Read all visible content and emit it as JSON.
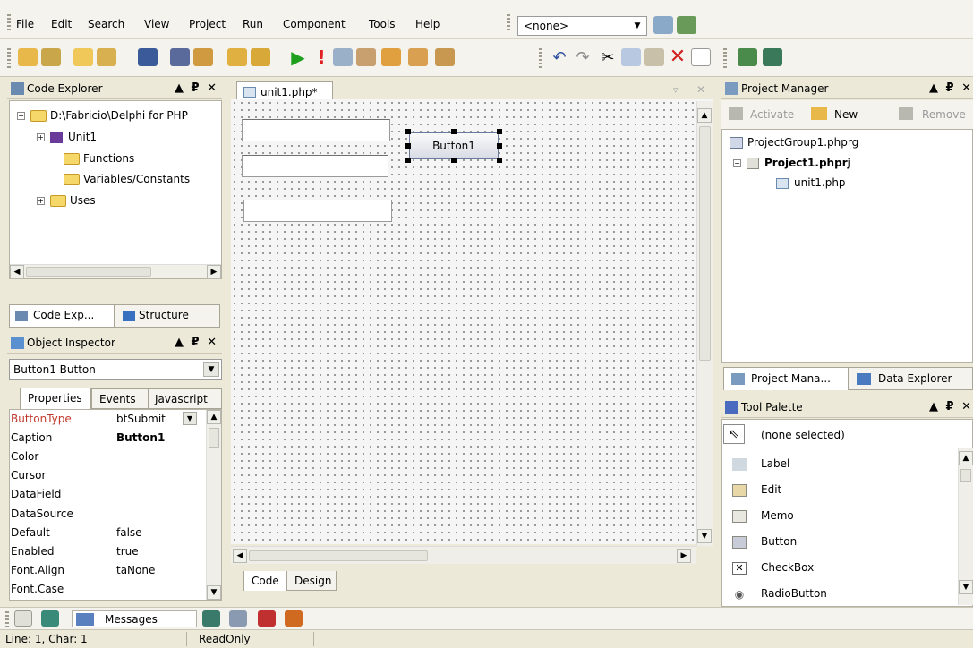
{
  "menubar": {
    "items": [
      "File",
      "Edit",
      "Search",
      "View",
      "Project",
      "Run",
      "Component",
      "Tools",
      "Help"
    ],
    "combo_value": "<none>"
  },
  "code_explorer": {
    "title": "Code Explorer",
    "root": "D:\\Fabricio\\Delphi for PHP",
    "unit": "Unit1",
    "functions": "Functions",
    "variables": "Variables/Constants",
    "uses": "Uses",
    "tab_code": "Code Exp...",
    "tab_structure": "Structure"
  },
  "object_inspector": {
    "title": "Object Inspector",
    "selected": "Button1  Button",
    "tabs": [
      "Properties",
      "Events",
      "Javascript"
    ],
    "rows": [
      {
        "name": "ButtonType",
        "value": "btSubmit"
      },
      {
        "name": "Caption",
        "value": "Button1"
      },
      {
        "name": "Color",
        "value": ""
      },
      {
        "name": "Cursor",
        "value": ""
      },
      {
        "name": "DataField",
        "value": ""
      },
      {
        "name": "DataSource",
        "value": ""
      },
      {
        "name": "Default",
        "value": "false"
      },
      {
        "name": "Enabled",
        "value": "true"
      },
      {
        "name": "Font.Align",
        "value": "taNone"
      },
      {
        "name": "Font.Case",
        "value": ""
      }
    ]
  },
  "editor": {
    "tab_label": "unit1.php*",
    "button_caption": "Button1",
    "bottom_tabs": [
      "Code",
      "Design"
    ]
  },
  "project_manager": {
    "title": "Project Manager",
    "activate": "Activate",
    "new": "New",
    "remove": "Remove",
    "group": "ProjectGroup1.phprg",
    "project": "Project1.phprj",
    "file": "unit1.php",
    "tab_pm": "Project Mana...",
    "tab_data": "Data Explorer"
  },
  "tool_palette": {
    "title": "Tool Palette",
    "none_selected": "(none selected)",
    "items": [
      "Label",
      "Edit",
      "Memo",
      "Button",
      "CheckBox",
      "RadioButton"
    ]
  },
  "messages": {
    "label": "Messages"
  },
  "status": {
    "position": "Line: 1, Char: 1",
    "mode": "ReadOnly"
  },
  "colors": {
    "highlight_prop": "#c0392b",
    "accent": "#3a6ea5"
  }
}
